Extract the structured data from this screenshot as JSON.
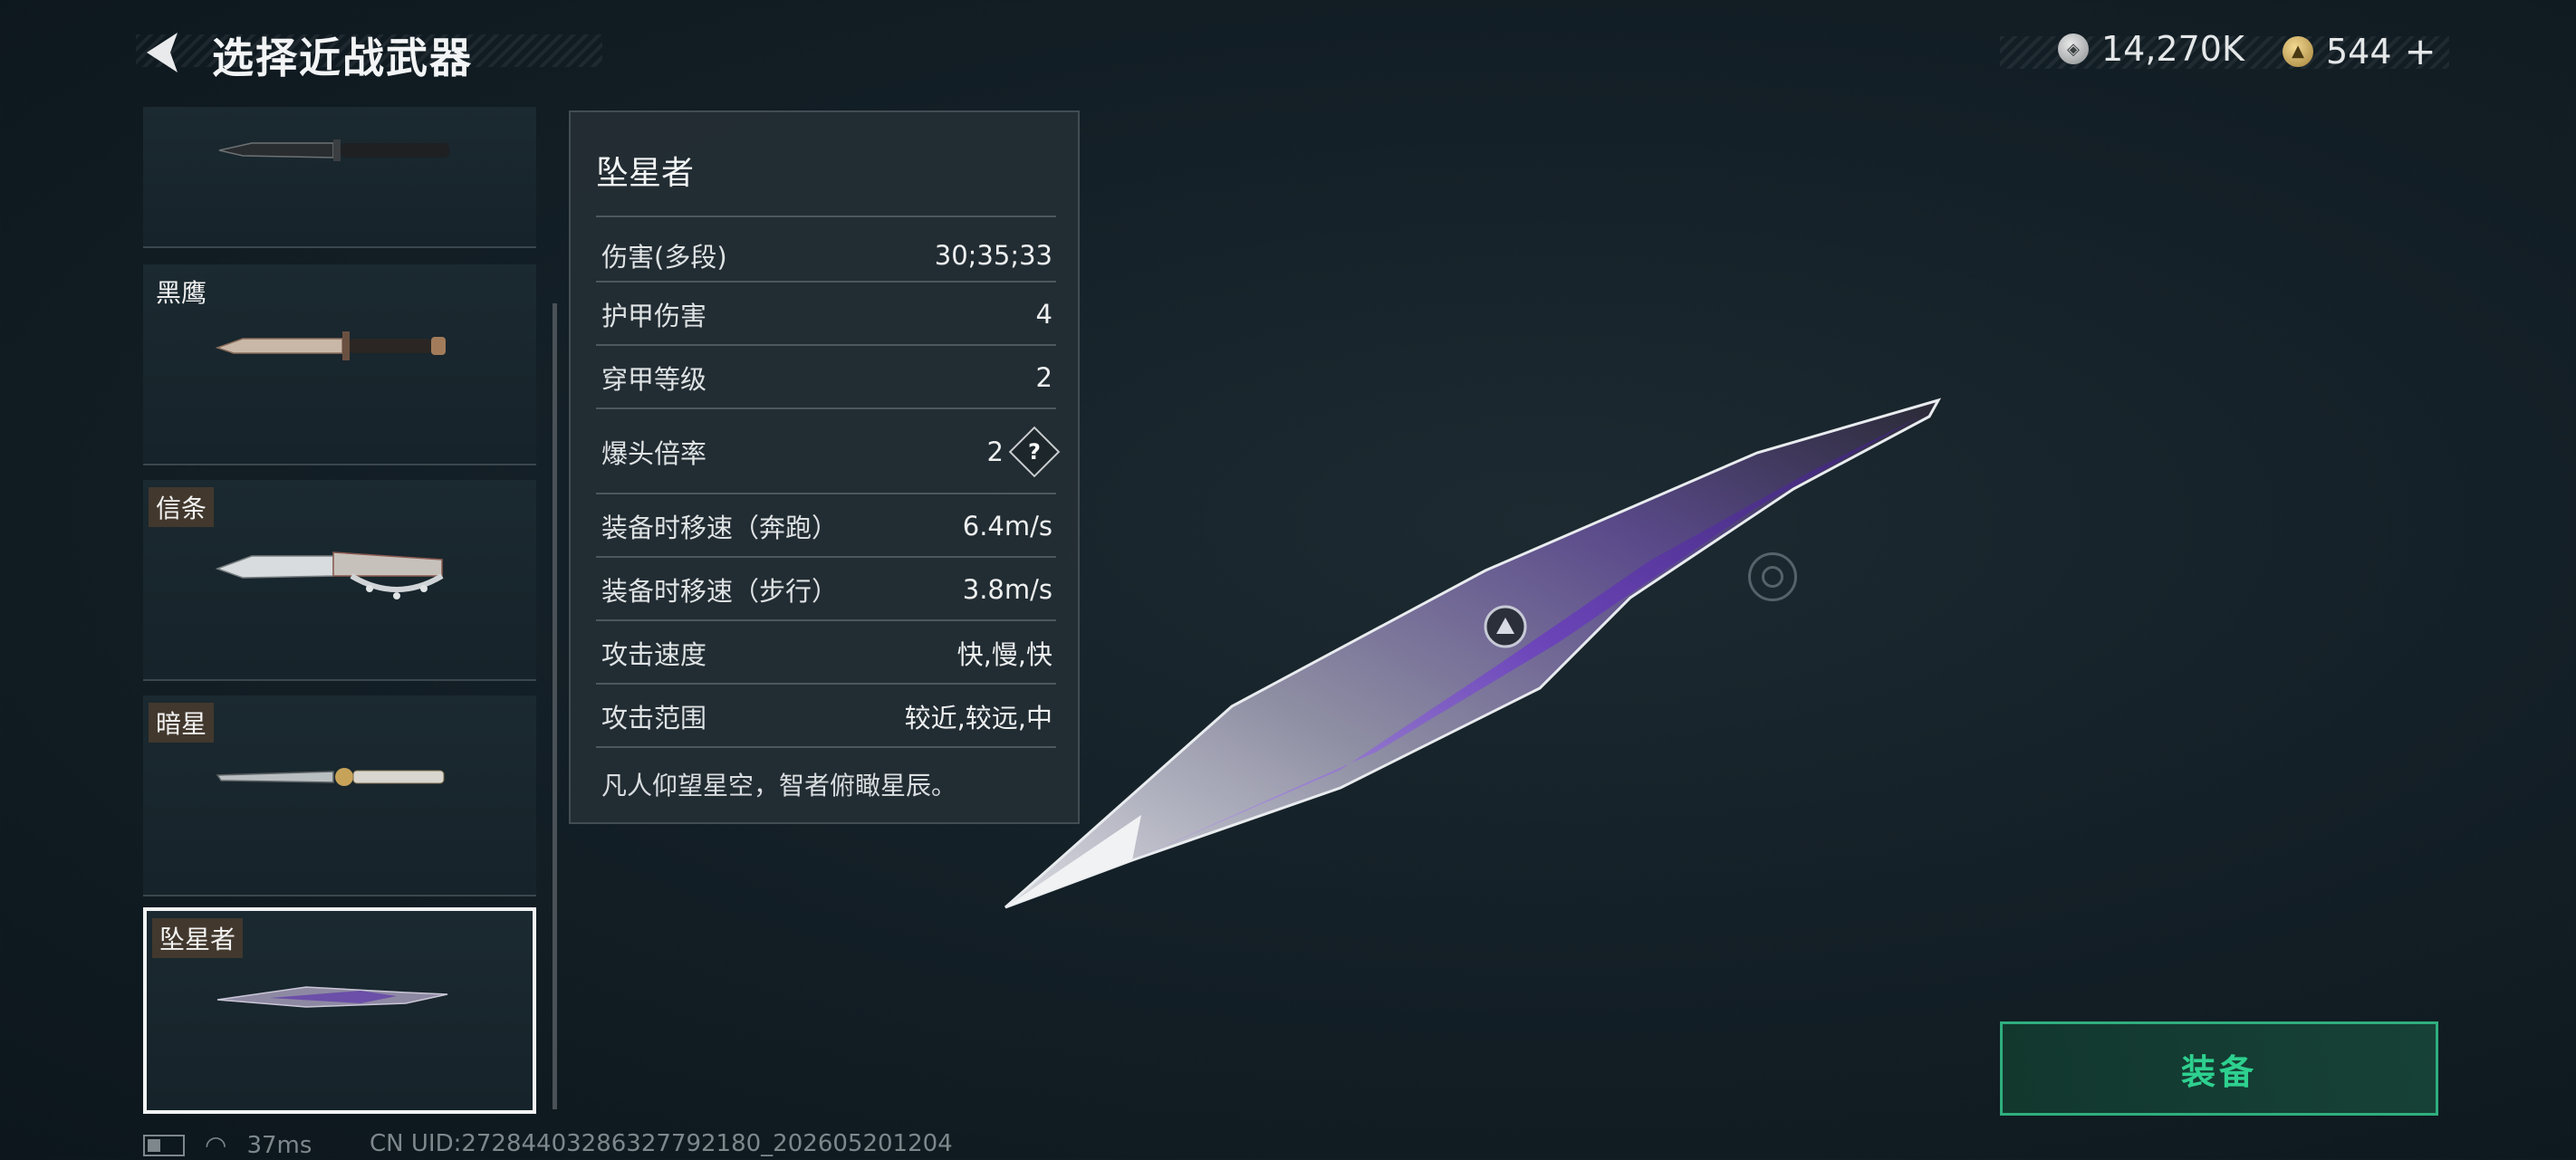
{
  "header": {
    "title": "选择近战武器",
    "currencies": [
      {
        "icon": "silver-coin-icon",
        "amount": "14,270K"
      },
      {
        "icon": "gold-coin-icon",
        "amount": "544",
        "add_symbol": "+"
      }
    ]
  },
  "weapon_list": {
    "items": [
      {
        "label": "",
        "icon": "combat-knife-icon"
      },
      {
        "label": "黑鹰",
        "icon": "bowie-knife-icon"
      },
      {
        "label": "信条",
        "icon": "knuckle-knife-icon"
      },
      {
        "label": "暗星",
        "icon": "dark-star-knife-icon"
      },
      {
        "label": "坠星者",
        "icon": "star-faller-knife-icon",
        "selected": true
      }
    ]
  },
  "stats_panel": {
    "title": "坠星者",
    "stats": [
      {
        "label": "伤害(多段)",
        "value": "30;35;33"
      },
      {
        "label": "护甲伤害",
        "value": "4"
      },
      {
        "label": "穿甲等级",
        "value": "2"
      },
      {
        "label": "爆头倍率",
        "value": "2",
        "help": "?"
      },
      {
        "label": "装备时移速（奔跑）",
        "value": "6.4m/s"
      },
      {
        "label": "装备时移速（步行）",
        "value": "3.8m/s"
      },
      {
        "label": "攻击速度",
        "value": "快,慢,快"
      },
      {
        "label": "攻击范围",
        "value": "较近,较远,中"
      }
    ],
    "flavor_text": "凡人仰望星空，智者俯瞰星辰。"
  },
  "equip_button": {
    "label": "装备"
  },
  "status_bar": {
    "ping": "37ms",
    "uid": "CN UID:2728440328632779218​0_202605201204"
  },
  "colors": {
    "accent": "#2ed08f",
    "background": "#142027",
    "panel": "#242e34"
  }
}
